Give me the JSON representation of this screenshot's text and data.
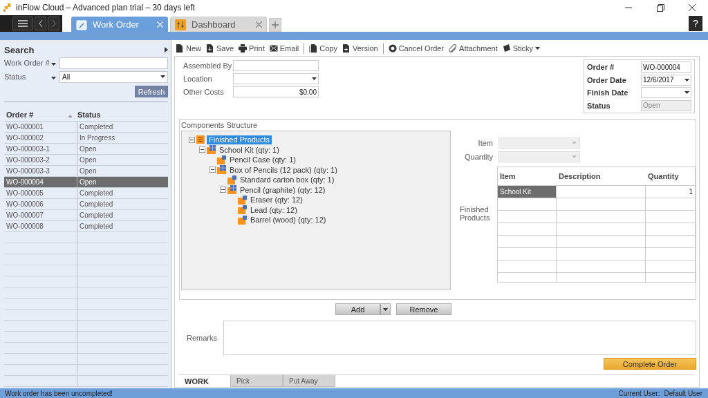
{
  "window": {
    "title": "inFlow Cloud – Advanced plan trial – 30 days left"
  },
  "tabs": [
    {
      "label": "Work Order",
      "selected": true,
      "kind": "order"
    },
    {
      "label": "Dashboard",
      "selected": false,
      "kind": "dashboard"
    }
  ],
  "help_button": "?",
  "search": {
    "title": "Search",
    "fields": [
      {
        "label": "Work Order #",
        "kind": "text"
      },
      {
        "label": "Status",
        "kind": "select",
        "value": "All"
      }
    ],
    "refresh": "Refresh"
  },
  "orders": {
    "columns": [
      {
        "label": "Order #",
        "sorted": true
      },
      {
        "label": "Status",
        "sorted": false
      }
    ],
    "rows": [
      {
        "order": "WO-000001",
        "status": "Completed",
        "selected": false
      },
      {
        "order": "WO-000002",
        "status": "In Progress",
        "selected": false
      },
      {
        "order": "WO-000003-1",
        "status": "Open",
        "selected": false
      },
      {
        "order": "WO-000003-2",
        "status": "Open",
        "selected": false
      },
      {
        "order": "WO-000003-3",
        "status": "Open",
        "selected": false
      },
      {
        "order": "WO-000004",
        "status": "Open",
        "selected": true
      },
      {
        "order": "WO-000005",
        "status": "Completed",
        "selected": false
      },
      {
        "order": "WO-000006",
        "status": "Completed",
        "selected": false
      },
      {
        "order": "WO-000007",
        "status": "Completed",
        "selected": false
      },
      {
        "order": "WO-000008",
        "status": "Completed",
        "selected": false
      }
    ]
  },
  "toolbar": [
    {
      "label": "New",
      "separator_after": false,
      "dropdown": false
    },
    {
      "label": "Save",
      "separator_after": false,
      "dropdown": false
    },
    {
      "label": "Print",
      "separator_after": false,
      "dropdown": false
    },
    {
      "label": "Email",
      "separator_after": true,
      "dropdown": false
    },
    {
      "label": "Copy",
      "separator_after": false,
      "dropdown": false
    },
    {
      "label": "Version",
      "separator_after": true,
      "dropdown": false
    },
    {
      "label": "Cancel Order",
      "separator_after": false,
      "dropdown": false
    },
    {
      "label": "Attachment",
      "separator_after": false,
      "dropdown": false
    },
    {
      "label": "Sticky",
      "separator_after": false,
      "dropdown": true
    }
  ],
  "form": [
    {
      "label": "Assembled By",
      "kind": "text"
    },
    {
      "label": "Location",
      "kind": "select"
    },
    {
      "label": "Other Costs",
      "kind": "money",
      "value": "$0.00"
    }
  ],
  "header": [
    {
      "label": "Order #",
      "kind": "text",
      "value": "WO-000004",
      "disabled": false
    },
    {
      "label": "Order Date",
      "kind": "select",
      "value": "12/6/2017",
      "disabled": false
    },
    {
      "label": "Finish Date",
      "kind": "select",
      "disabled": false
    },
    {
      "label": "Status",
      "kind": "text",
      "value": "Open",
      "disabled": true
    }
  ],
  "components": {
    "title": "Components Structure",
    "tree": [
      {
        "label": "Finished Products",
        "kind": "root",
        "selected": true,
        "expanded": true,
        "children": [
          {
            "label": "School Kit  (qty: 1)",
            "kind": "assembly",
            "selected": false,
            "expanded": true,
            "children": [
              {
                "label": "Pencil Case  (qty: 1)",
                "kind": "part",
                "selected": false
              },
              {
                "label": "Box of Pencils (12 pack)  (qty: 1)",
                "kind": "assembly",
                "selected": false,
                "expanded": true,
                "children": [
                  {
                    "label": "Standard carton box   (qty: 1)",
                    "kind": "part",
                    "selected": false
                  },
                  {
                    "label": "Pencil (graphite)  (qty: 12)",
                    "kind": "assembly",
                    "selected": false,
                    "expanded": true,
                    "children": [
                      {
                        "label": "Eraser  (qty: 12)",
                        "kind": "part",
                        "selected": false
                      },
                      {
                        "label": "Lead  (qty: 12)",
                        "kind": "part",
                        "selected": false
                      },
                      {
                        "label": "Barrel (wood)  (qty: 12)",
                        "kind": "part",
                        "selected": false
                      }
                    ]
                  }
                ]
              }
            ]
          }
        ]
      }
    ],
    "selectors": [
      {
        "label": "Item",
        "disabled": true
      },
      {
        "label": "Quantity",
        "disabled": true
      }
    ],
    "finished_label": "Finished Products",
    "finished": {
      "columns": [
        "Item",
        "Description",
        "Quantity"
      ],
      "rows": [
        {
          "item": "School Kit",
          "description": "",
          "quantity": "1",
          "selected": true
        }
      ]
    },
    "add_button": "Add",
    "remove_button": "Remove"
  },
  "remarks_label": "Remarks",
  "complete_button": "Complete Order",
  "bottom_tabs": [
    {
      "label": "WORK",
      "selected": true
    },
    {
      "label": "Pick",
      "selected": false
    },
    {
      "label": "Put Away",
      "selected": false
    }
  ],
  "status_bar": {
    "message": "Work order has been uncompleted!",
    "user_label": "Current User:",
    "user": "Default User"
  }
}
